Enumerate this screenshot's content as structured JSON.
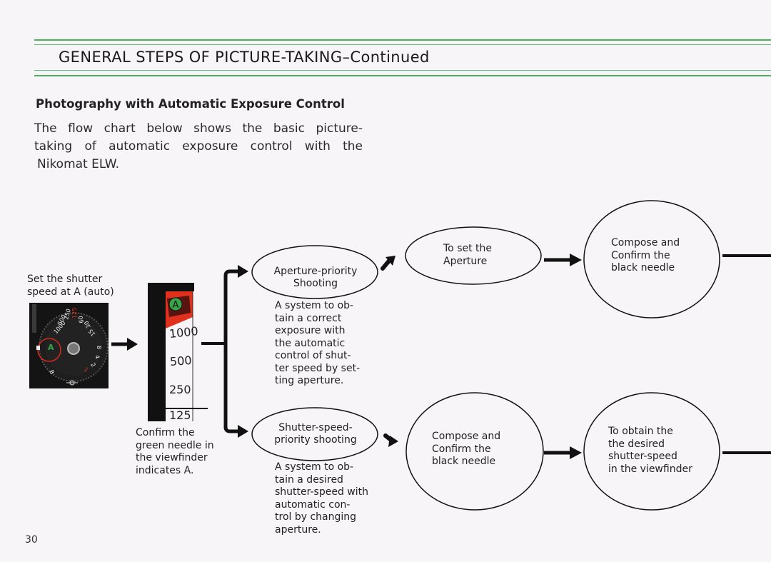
{
  "header": {
    "title": "GENERAL  STEPS  OF  PICTURE-TAKING–Continued",
    "rule_color": "#4caf5a"
  },
  "section": {
    "subtitle": "Photography with Automatic Exposure Control",
    "intro_lines": [
      "The  flow  chart  below  shows  the  basic  picture-",
      "taking  of  automatic  exposure  control  with  the",
      "Nikomat  ELW."
    ]
  },
  "step1": {
    "caption_lines": [
      "Set the shutter",
      "speed at A (auto)"
    ],
    "dial_labels": [
      "1000",
      "500",
      "250",
      "125",
      "60",
      "30",
      "15",
      "8",
      "4",
      "2",
      "1",
      "A",
      "B"
    ],
    "dial_selected": "A"
  },
  "step2": {
    "viewfinder_mode": "A",
    "viewfinder_scale": [
      "1000",
      "500",
      "250",
      "125"
    ],
    "caption_lines": [
      "Confirm the",
      "green needle in",
      "the viewfinder",
      "indicates A."
    ]
  },
  "branch_aperture": {
    "ellipse_lines": [
      "Aperture-priority",
      "Shooting"
    ],
    "description_lines": [
      "A system to ob-",
      "tain a correct",
      "exposure with",
      "the automatic",
      "control of shut-",
      "ter speed by set-",
      "ting aperture."
    ],
    "next": {
      "lines": [
        "To set the",
        "Aperture"
      ]
    },
    "final": {
      "lines": [
        "Compose and",
        "Confirm the",
        "black needle"
      ]
    }
  },
  "branch_shutter": {
    "ellipse_lines": [
      "Shutter-speed-",
      "priority shooting"
    ],
    "description_lines": [
      "A system to ob-",
      "tain a desired",
      "shutter-speed with",
      "automatic con-",
      "trol by changing",
      "aperture."
    ],
    "next": {
      "lines": [
        "Compose  and",
        "Confirm the",
        "black needle"
      ]
    },
    "final": {
      "lines": [
        "To obtain the",
        "the desired",
        "shutter-speed",
        "in the viewfinder"
      ]
    }
  },
  "footer": {
    "page_number": "30"
  },
  "colors": {
    "accent_green": "#4caf5a",
    "indicator_red": "#e0301e",
    "indicator_green": "#3aa548"
  }
}
